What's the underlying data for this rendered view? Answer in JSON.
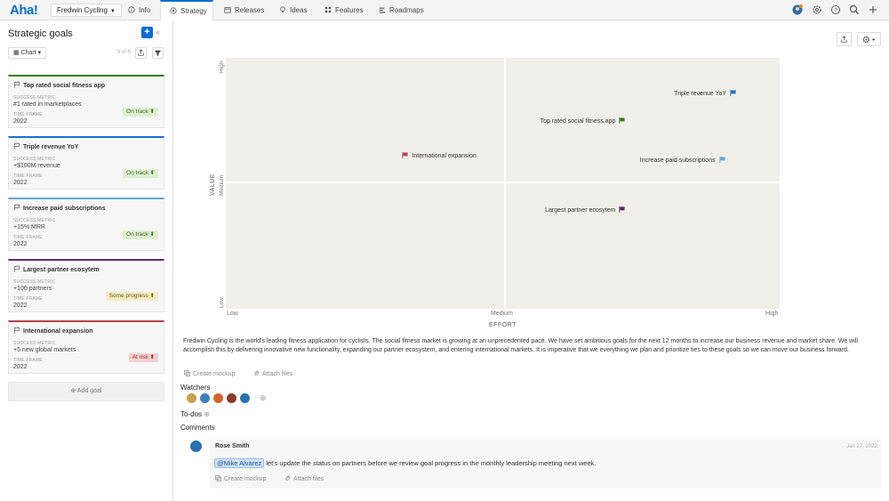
{
  "app": {
    "logo": "Aha!",
    "workspace": "Fredwin Cycling"
  },
  "nav": {
    "tabs": [
      {
        "label": "Info",
        "icon": "info-icon"
      },
      {
        "label": "Strategy",
        "icon": "strategy-icon",
        "active": true
      },
      {
        "label": "Releases",
        "icon": "calendar-icon"
      },
      {
        "label": "Ideas",
        "icon": "lightbulb-icon"
      },
      {
        "label": "Features",
        "icon": "features-icon"
      },
      {
        "label": "Roadmaps",
        "icon": "roadmap-icon"
      }
    ],
    "right_icons": [
      "user-avatar-icon",
      "gear-icon",
      "help-icon",
      "search-icon",
      "plus-icon"
    ]
  },
  "sidebar": {
    "title": "Strategic goals",
    "view_label": "Chart",
    "count": "5 of 5",
    "metric_label": "SUCCESS METRIC",
    "timeframe_label": "TIME FRAME",
    "goals": [
      {
        "name": "Top rated social fitness app",
        "metric": "#1 rated in marketplaces",
        "timeframe": "2022",
        "status": "On track ⬍",
        "color": "#3d7a1f"
      },
      {
        "name": "Triple revenue YoY",
        "metric": "+$100M revenue",
        "timeframe": "2022",
        "status": "On track ⬍",
        "color": "#1f6fc4"
      },
      {
        "name": "Increase paid subscriptions",
        "metric": "+15% MRR",
        "timeframe": "2022",
        "status": "On track ⬍",
        "color": "#5fa6d6"
      },
      {
        "name": "Largest partner ecosytem",
        "metric": "+100 partners",
        "timeframe": "2022",
        "status": "Some progress ⬍",
        "color": "#5b2d5c"
      },
      {
        "name": "International expansion",
        "metric": "+5 new global markets",
        "timeframe": "2022",
        "status": "At risk ⬍",
        "color": "#b2434a"
      }
    ],
    "add_label": "Add goal"
  },
  "chart_data": {
    "type": "scatter",
    "xlabel": "EFFORT",
    "ylabel": "VALUE",
    "x_ticks": [
      "Low",
      "Medium",
      "High"
    ],
    "y_ticks": [
      "Low",
      "Medium",
      "High"
    ],
    "xlim": [
      0,
      1
    ],
    "ylim": [
      0,
      1
    ],
    "points": [
      {
        "label": "Triple revenue YoY",
        "x": 0.915,
        "y": 0.855,
        "color": "#1f6fc4",
        "label_side": "left"
      },
      {
        "label": "Top rated social fitness app",
        "x": 0.715,
        "y": 0.745,
        "color": "#3d7a1f",
        "label_side": "left"
      },
      {
        "label": "International expansion",
        "x": 0.325,
        "y": 0.605,
        "color": "#b2434a",
        "label_side": "right"
      },
      {
        "label": "Increase paid subscriptions",
        "x": 0.895,
        "y": 0.59,
        "color": "#5fa6d6",
        "label_side": "left"
      },
      {
        "label": "Largest partner ecosytem",
        "x": 0.715,
        "y": 0.39,
        "color": "#5b2d5c",
        "label_side": "left"
      }
    ]
  },
  "description": "Fredwin Cycling is the world's leading fitness application for cyclists. The social fitness market is growing at an unprecedented pace. We have set ambitious goals for the next 12 months to increase our business revenue and market share. We will accomplish this by delivering innovative new functionality, expanding our partner ecosystem, and entering international markets. It is imperative that we everything we plan and prioritize ties to these goals so we can move our business forward.",
  "actions": {
    "create_mockup": "Create mockup",
    "attach_files": "Attach files"
  },
  "watchers": {
    "title": "Watchers",
    "more": "···"
  },
  "todos": {
    "title": "To-dos"
  },
  "comments": {
    "title": "Comments",
    "items": [
      {
        "author": "Rose Smith",
        "date": "Jan 27, 2022",
        "mention": "@Mike Alvarez",
        "text": "let's update the status on partners before we review goal progress in the monthly leadership meeting next week."
      }
    ]
  }
}
